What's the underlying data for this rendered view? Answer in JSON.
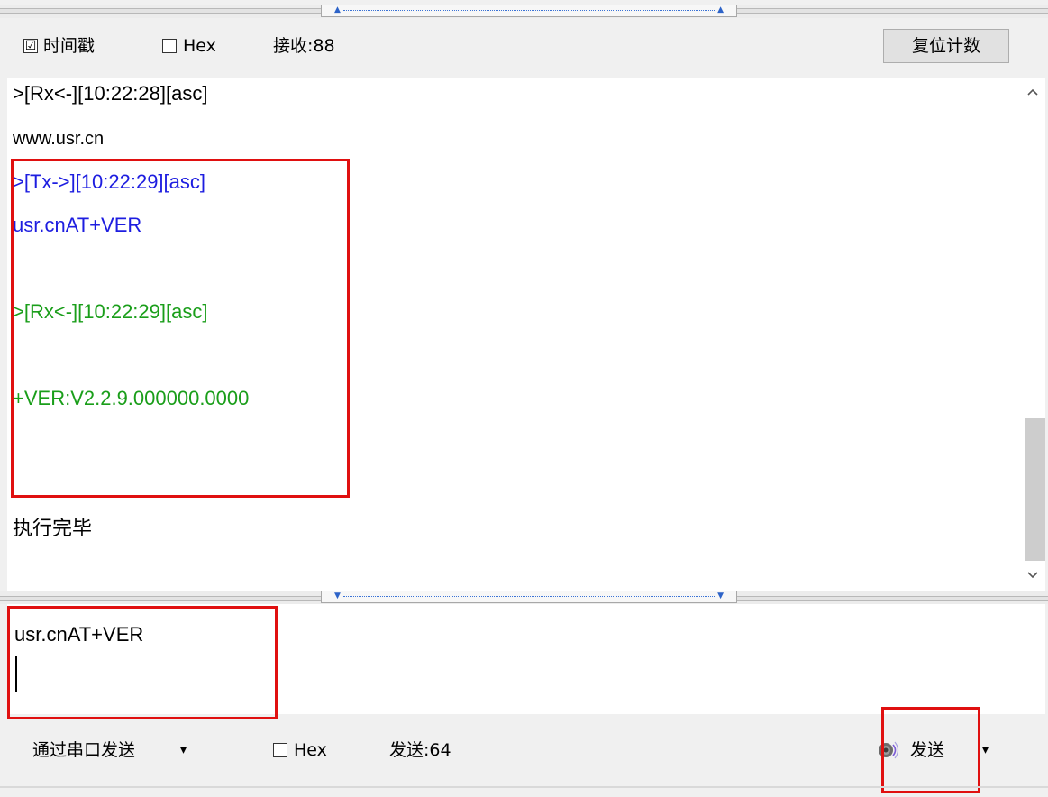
{
  "toolbar": {
    "timestamp_checked": "☑",
    "timestamp_label": "时间戳",
    "hex_label": "Hex",
    "received_label": "接收:88",
    "reset_button": "复位计数"
  },
  "receive_log": [
    {
      "text": ">[Rx<-][10:22:28][asc]",
      "color": "#000000"
    },
    {
      "text": "www.usr.cn",
      "color": "#000000"
    },
    {
      "text": ">[Tx->][10:22:29][asc]",
      "color": "#1d1de0"
    },
    {
      "text": "usr.cnAT+VER",
      "color": "#1d1de0"
    },
    {
      "text": ">[Rx<-][10:22:29][asc]",
      "color": "#1a9e1a"
    },
    {
      "text": "+VER:V2.2.9.000000.0000",
      "color": "#1a9e1a"
    },
    {
      "text": "执行完毕",
      "color": "#000000"
    }
  ],
  "scrollbar": {
    "up_icon": "^",
    "down_icon": "v"
  },
  "send_input": {
    "value": "usr.cnAT+VER"
  },
  "bottombar": {
    "send_via_label": "通过串口发送",
    "dropdown_arrow": "▾",
    "hex_label": "Hex",
    "sent_label": "发送:64",
    "send_button": "发送",
    "send_dropdown_arrow": "▾"
  },
  "highlight_color": "#e01010"
}
